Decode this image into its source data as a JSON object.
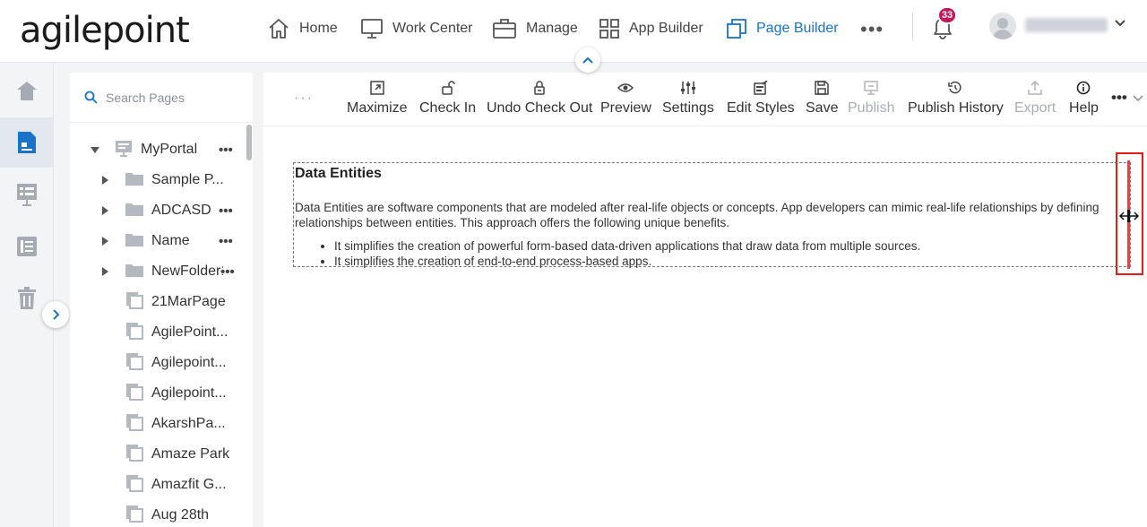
{
  "header": {
    "logo_text": "agilepoint",
    "nav": [
      {
        "label": "Home",
        "icon": "home-icon"
      },
      {
        "label": "Work Center",
        "icon": "monitor-icon"
      },
      {
        "label": "Manage",
        "icon": "briefcase-icon"
      },
      {
        "label": "App Builder",
        "icon": "grid-icon"
      },
      {
        "label": "Page Builder",
        "icon": "page-builder-icon",
        "active": true
      }
    ],
    "more_label": "•••",
    "notification_count": "33",
    "accent_color": "#1a73c7",
    "badge_color": "#c2185b"
  },
  "rail": {
    "items": [
      "home-icon",
      "page-icon",
      "form-icon",
      "list-icon",
      "trash-icon"
    ],
    "active_index": 1
  },
  "tree": {
    "search_placeholder": "Search Pages",
    "root": {
      "label": "MyPortal",
      "dots": "•••"
    },
    "folders": [
      {
        "label": "Sample P...",
        "dots": ""
      },
      {
        "label": "ADCASD",
        "dots": "•••"
      },
      {
        "label": "Name",
        "dots": "•••"
      },
      {
        "label": "NewFolder1",
        "dots": "•••"
      }
    ],
    "pages": [
      "21MarPage",
      "AgilePoint...",
      "Agilepoint...",
      "Agilepoint...",
      "AkarshPa...",
      "Amaze Park",
      "Amazfit G...",
      "Aug 28th"
    ]
  },
  "toolbar": {
    "drag_handle": "···",
    "buttons": [
      {
        "label": "Maximize",
        "icon": "maximize-icon",
        "enabled": true
      },
      {
        "label": "Check In",
        "icon": "unlock-icon",
        "enabled": true
      },
      {
        "label": "Undo Check Out",
        "icon": "undo-lock-icon",
        "enabled": true
      },
      {
        "label": "Preview",
        "icon": "eye-icon",
        "enabled": true
      },
      {
        "label": "Settings",
        "icon": "sliders-icon",
        "enabled": true
      },
      {
        "label": "Edit Styles",
        "icon": "edit-styles-icon",
        "enabled": true
      },
      {
        "label": "Save",
        "icon": "save-icon",
        "enabled": true
      },
      {
        "label": "Publish",
        "icon": "publish-icon",
        "enabled": false
      },
      {
        "label": "Publish History",
        "icon": "history-icon",
        "enabled": true
      },
      {
        "label": "Export",
        "icon": "export-icon",
        "enabled": false
      },
      {
        "label": "Help",
        "icon": "info-icon",
        "enabled": true
      }
    ],
    "more_label": "•••"
  },
  "content": {
    "title": "Data Entities",
    "paragraph": "Data Entities are software components that are modeled after real-life objects or concepts. App developers can mimic real-life relationships by defining relationships between entities. This approach offers the following unique benefits.",
    "bullets": [
      "It simplifies the creation of powerful form-based data-driven applications that draw data from multiple sources.",
      "It simplifies the creation of end-to-end process-based apps."
    ]
  }
}
